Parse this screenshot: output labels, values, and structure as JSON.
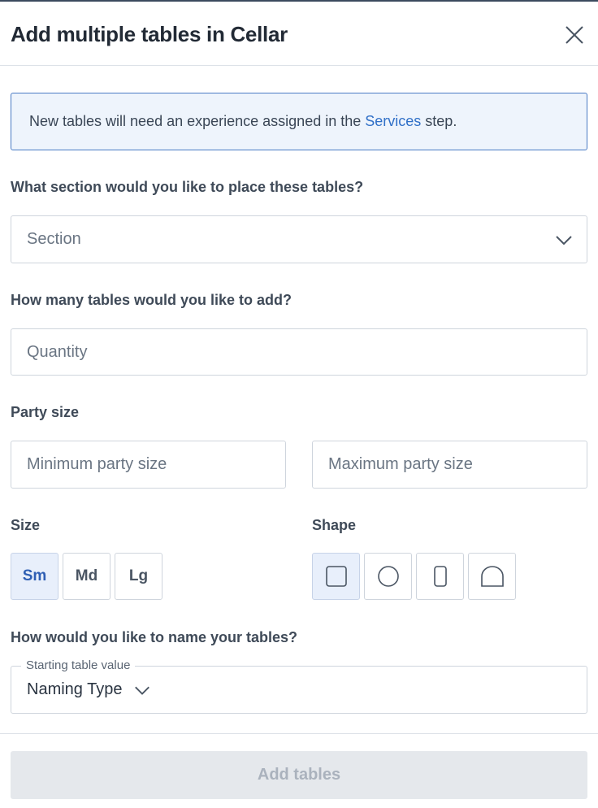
{
  "dialog": {
    "title": "Add multiple tables in Cellar"
  },
  "info": {
    "text_before": "New tables will need an experience assigned in the ",
    "link": "Services",
    "text_after": " step."
  },
  "section": {
    "label": "What section would you like to place these tables?",
    "placeholder": "Section"
  },
  "quantity": {
    "label": "How many tables would you like to add?",
    "placeholder": "Quantity"
  },
  "party_size": {
    "label": "Party size",
    "min_placeholder": "Minimum party size",
    "max_placeholder": "Maximum party size"
  },
  "size": {
    "label": "Size",
    "options": [
      "Sm",
      "Md",
      "Lg"
    ],
    "selected": "Sm"
  },
  "shape": {
    "label": "Shape",
    "options": [
      "square-icon",
      "circle-icon",
      "rectangle-icon",
      "arch-icon"
    ],
    "selected": "square-icon"
  },
  "naming": {
    "label": "How would you like to name your tables?",
    "legend": "Starting table value",
    "value": "Naming Type"
  },
  "footer": {
    "submit_label": "Add tables",
    "submit_enabled": false
  },
  "colors": {
    "accent": "#2f6fc7",
    "info_bg": "#eef4fc",
    "disabled_bg": "#e5e8ec"
  }
}
